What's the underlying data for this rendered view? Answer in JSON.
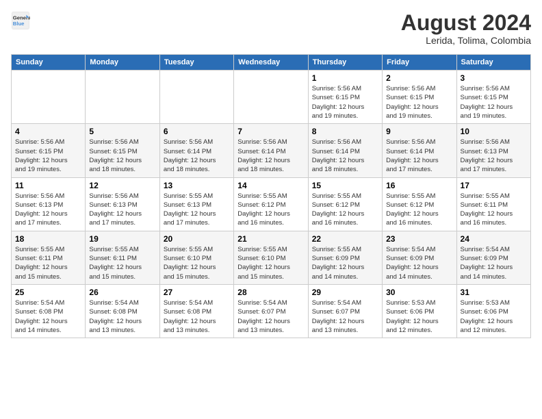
{
  "header": {
    "logo_line1": "General",
    "logo_line2": "Blue",
    "month_year": "August 2024",
    "location": "Lerida, Tolima, Colombia"
  },
  "days_of_week": [
    "Sunday",
    "Monday",
    "Tuesday",
    "Wednesday",
    "Thursday",
    "Friday",
    "Saturday"
  ],
  "weeks": [
    [
      {
        "day": "",
        "info": ""
      },
      {
        "day": "",
        "info": ""
      },
      {
        "day": "",
        "info": ""
      },
      {
        "day": "",
        "info": ""
      },
      {
        "day": "1",
        "info": "Sunrise: 5:56 AM\nSunset: 6:15 PM\nDaylight: 12 hours\nand 19 minutes."
      },
      {
        "day": "2",
        "info": "Sunrise: 5:56 AM\nSunset: 6:15 PM\nDaylight: 12 hours\nand 19 minutes."
      },
      {
        "day": "3",
        "info": "Sunrise: 5:56 AM\nSunset: 6:15 PM\nDaylight: 12 hours\nand 19 minutes."
      }
    ],
    [
      {
        "day": "4",
        "info": "Sunrise: 5:56 AM\nSunset: 6:15 PM\nDaylight: 12 hours\nand 19 minutes."
      },
      {
        "day": "5",
        "info": "Sunrise: 5:56 AM\nSunset: 6:15 PM\nDaylight: 12 hours\nand 18 minutes."
      },
      {
        "day": "6",
        "info": "Sunrise: 5:56 AM\nSunset: 6:14 PM\nDaylight: 12 hours\nand 18 minutes."
      },
      {
        "day": "7",
        "info": "Sunrise: 5:56 AM\nSunset: 6:14 PM\nDaylight: 12 hours\nand 18 minutes."
      },
      {
        "day": "8",
        "info": "Sunrise: 5:56 AM\nSunset: 6:14 PM\nDaylight: 12 hours\nand 18 minutes."
      },
      {
        "day": "9",
        "info": "Sunrise: 5:56 AM\nSunset: 6:14 PM\nDaylight: 12 hours\nand 17 minutes."
      },
      {
        "day": "10",
        "info": "Sunrise: 5:56 AM\nSunset: 6:13 PM\nDaylight: 12 hours\nand 17 minutes."
      }
    ],
    [
      {
        "day": "11",
        "info": "Sunrise: 5:56 AM\nSunset: 6:13 PM\nDaylight: 12 hours\nand 17 minutes."
      },
      {
        "day": "12",
        "info": "Sunrise: 5:56 AM\nSunset: 6:13 PM\nDaylight: 12 hours\nand 17 minutes."
      },
      {
        "day": "13",
        "info": "Sunrise: 5:55 AM\nSunset: 6:13 PM\nDaylight: 12 hours\nand 17 minutes."
      },
      {
        "day": "14",
        "info": "Sunrise: 5:55 AM\nSunset: 6:12 PM\nDaylight: 12 hours\nand 16 minutes."
      },
      {
        "day": "15",
        "info": "Sunrise: 5:55 AM\nSunset: 6:12 PM\nDaylight: 12 hours\nand 16 minutes."
      },
      {
        "day": "16",
        "info": "Sunrise: 5:55 AM\nSunset: 6:12 PM\nDaylight: 12 hours\nand 16 minutes."
      },
      {
        "day": "17",
        "info": "Sunrise: 5:55 AM\nSunset: 6:11 PM\nDaylight: 12 hours\nand 16 minutes."
      }
    ],
    [
      {
        "day": "18",
        "info": "Sunrise: 5:55 AM\nSunset: 6:11 PM\nDaylight: 12 hours\nand 15 minutes."
      },
      {
        "day": "19",
        "info": "Sunrise: 5:55 AM\nSunset: 6:11 PM\nDaylight: 12 hours\nand 15 minutes."
      },
      {
        "day": "20",
        "info": "Sunrise: 5:55 AM\nSunset: 6:10 PM\nDaylight: 12 hours\nand 15 minutes."
      },
      {
        "day": "21",
        "info": "Sunrise: 5:55 AM\nSunset: 6:10 PM\nDaylight: 12 hours\nand 15 minutes."
      },
      {
        "day": "22",
        "info": "Sunrise: 5:55 AM\nSunset: 6:09 PM\nDaylight: 12 hours\nand 14 minutes."
      },
      {
        "day": "23",
        "info": "Sunrise: 5:54 AM\nSunset: 6:09 PM\nDaylight: 12 hours\nand 14 minutes."
      },
      {
        "day": "24",
        "info": "Sunrise: 5:54 AM\nSunset: 6:09 PM\nDaylight: 12 hours\nand 14 minutes."
      }
    ],
    [
      {
        "day": "25",
        "info": "Sunrise: 5:54 AM\nSunset: 6:08 PM\nDaylight: 12 hours\nand 14 minutes."
      },
      {
        "day": "26",
        "info": "Sunrise: 5:54 AM\nSunset: 6:08 PM\nDaylight: 12 hours\nand 13 minutes."
      },
      {
        "day": "27",
        "info": "Sunrise: 5:54 AM\nSunset: 6:08 PM\nDaylight: 12 hours\nand 13 minutes."
      },
      {
        "day": "28",
        "info": "Sunrise: 5:54 AM\nSunset: 6:07 PM\nDaylight: 12 hours\nand 13 minutes."
      },
      {
        "day": "29",
        "info": "Sunrise: 5:54 AM\nSunset: 6:07 PM\nDaylight: 12 hours\nand 13 minutes."
      },
      {
        "day": "30",
        "info": "Sunrise: 5:53 AM\nSunset: 6:06 PM\nDaylight: 12 hours\nand 12 minutes."
      },
      {
        "day": "31",
        "info": "Sunrise: 5:53 AM\nSunset: 6:06 PM\nDaylight: 12 hours\nand 12 minutes."
      }
    ]
  ]
}
